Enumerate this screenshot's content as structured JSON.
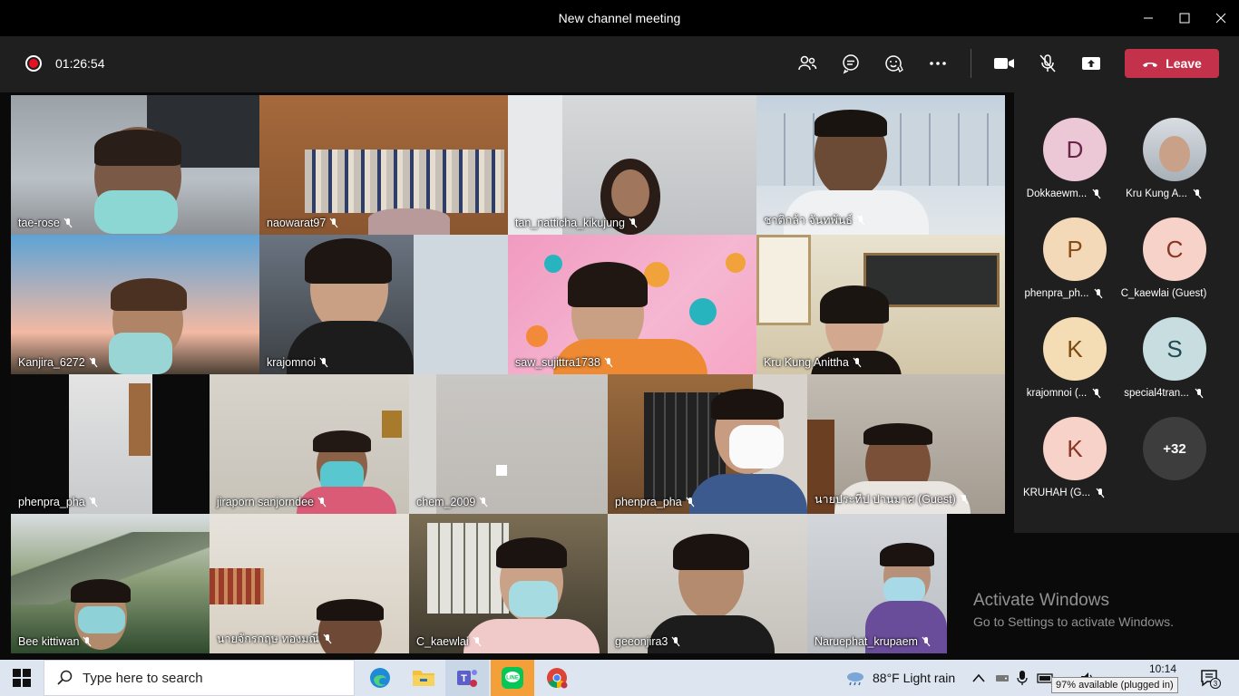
{
  "window": {
    "title": "New channel meeting"
  },
  "meeting": {
    "timer": "01:26:54",
    "leave_label": "Leave"
  },
  "tiles": [
    {
      "name": "tae-rose"
    },
    {
      "name": "naowarat97"
    },
    {
      "name": "tan_natticha_kikujung"
    },
    {
      "name": "ชาติกล้า จันทพันธ์"
    },
    {
      "name": "Kanjira_6272"
    },
    {
      "name": "krajomnoi"
    },
    {
      "name": "saw_sujittra1738"
    },
    {
      "name": "Kru Kung Anittha"
    },
    {
      "name": "phenpra_pha"
    },
    {
      "name": "jiraporn sanjorndee"
    },
    {
      "name": "chem_2009"
    },
    {
      "name": "phenpra_pha"
    },
    {
      "name": "นายประทีป ปานมาศ (Guest)"
    },
    {
      "name": "Bee kittiwan"
    },
    {
      "name": "นายจักรกฤษ ทองมณี"
    },
    {
      "name": "C_kaewlai"
    },
    {
      "name": "geeonjira3"
    },
    {
      "name": "Naruephat_krupaem"
    }
  ],
  "roster": [
    {
      "initial": "D",
      "label": "Dokkaewm...",
      "color": "#ecc7d6"
    },
    {
      "initial": "",
      "label": "Kru Kung A...",
      "color": "#cfd8e0"
    },
    {
      "initial": "P",
      "label": "phenpra_ph...",
      "color": "#f4d9b8"
    },
    {
      "initial": "C",
      "label": "C_kaewlai (Guest)",
      "color": "#f7d2c8"
    },
    {
      "initial": "K",
      "label": "krajomnoi (...",
      "color": "#f4dcb4"
    },
    {
      "initial": "S",
      "label": "special4tran...",
      "color": "#c8dde0"
    },
    {
      "initial": "K",
      "label": "KRUHAH (G...",
      "color": "#f7d2c8"
    },
    {
      "initial": "+32",
      "label": "",
      "color": "#3d3d3d"
    }
  ],
  "watermark": {
    "line1": "Activate Windows",
    "line2": "Go to Settings to activate Windows."
  },
  "taskbar": {
    "search_placeholder": "Type here to search",
    "weather": "88°F  Light rain",
    "time": "10:14",
    "battery_tooltip": "97% available (plugged in)",
    "notification_count": "3"
  }
}
